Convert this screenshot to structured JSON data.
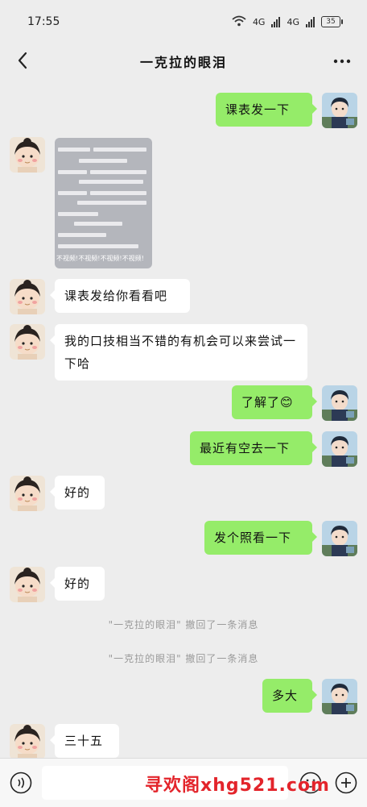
{
  "status_bar": {
    "time": "17:55",
    "network_1": "4G",
    "network_2": "4G",
    "battery": "35"
  },
  "header": {
    "title": "一克拉的眼泪"
  },
  "messages": [
    {
      "side": "out",
      "text": "课表发一下"
    },
    {
      "side": "in",
      "type": "image",
      "caption_lines": [
        "不视频!",
        "不视频!",
        "不视频!",
        "不视频!"
      ]
    },
    {
      "side": "in",
      "text": "课表发给你看看吧"
    },
    {
      "side": "in",
      "text": "我的口技相当不错的有机会可以来尝试一下哈"
    },
    {
      "side": "out",
      "text": "了解了😊"
    },
    {
      "side": "out",
      "text": "最近有空去一下"
    },
    {
      "side": "in",
      "text": "好的"
    },
    {
      "side": "out",
      "text": "发个照看一下"
    },
    {
      "side": "in",
      "text": "好的"
    },
    {
      "side": "out",
      "text": "多大"
    },
    {
      "side": "in",
      "text": "三十五"
    }
  ],
  "system_notices": [
    "\"一克拉的眼泪\" 撤回了一条消息",
    "\"一克拉的眼泪\" 撤回了一条消息"
  ],
  "input_bar": {
    "placeholder": ""
  },
  "watermark": "寻欢阁xhg521.com",
  "colors": {
    "background": "#ededed",
    "incoming_bubble": "#ffffff",
    "outgoing_bubble": "#95ec69",
    "watermark": "#e3242b"
  },
  "icons": [
    "back-icon",
    "more-icon",
    "wifi-icon",
    "signal-icon",
    "battery-icon",
    "voice-icon",
    "emoji-icon",
    "plus-icon"
  ]
}
